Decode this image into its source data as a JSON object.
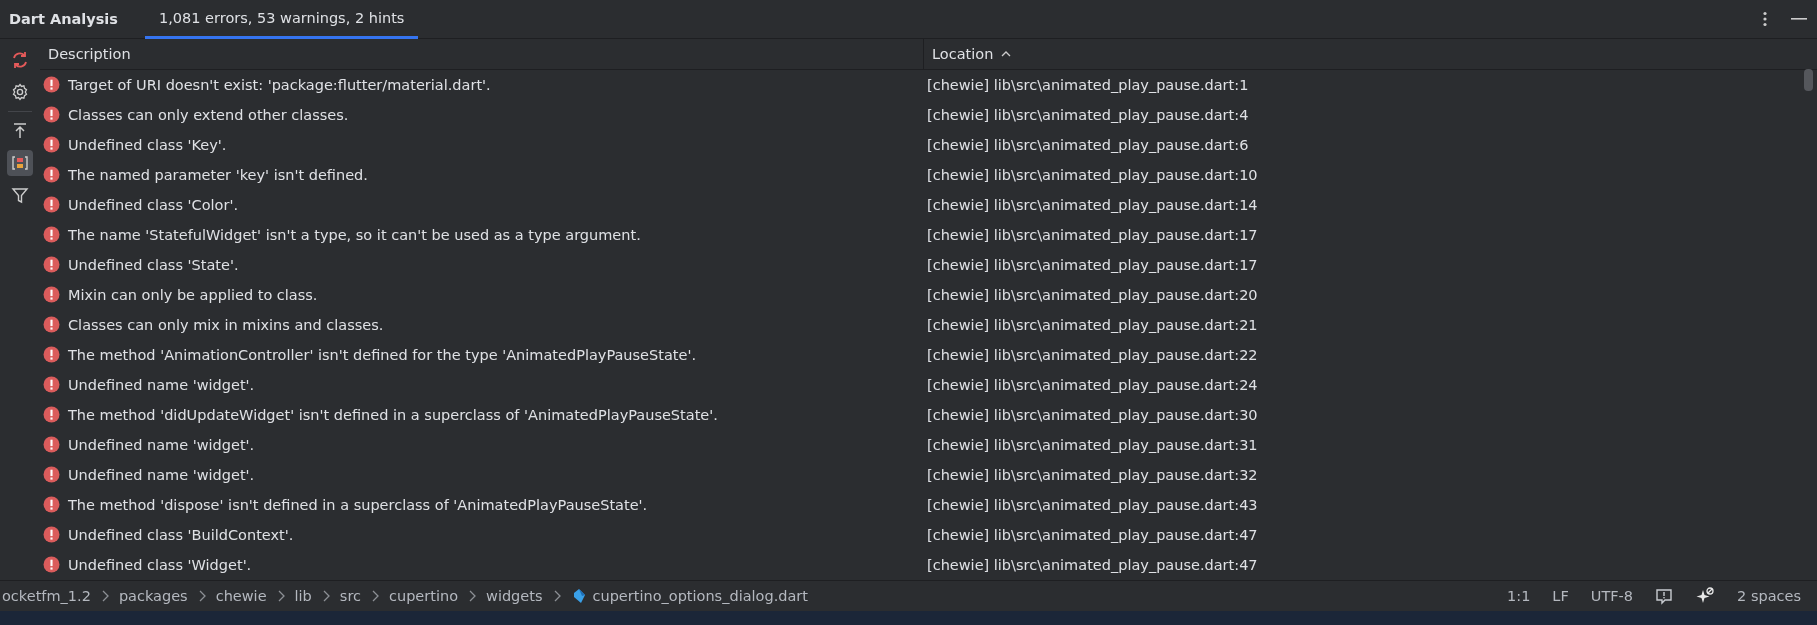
{
  "panel": {
    "title": "Dart Analysis",
    "tabs": [
      {
        "label": "1,081 errors, 53 warnings, 2 hints",
        "selected": true
      }
    ]
  },
  "toolbar": [
    {
      "kind": "refresh",
      "selected": false
    },
    {
      "kind": "settings",
      "selected": false
    },
    {
      "kind": "divider"
    },
    {
      "kind": "export",
      "selected": false
    },
    {
      "kind": "group",
      "selected": true
    },
    {
      "kind": "filter",
      "selected": false
    }
  ],
  "table": {
    "columns": [
      {
        "label": "Description",
        "sorted": false
      },
      {
        "label": "Location",
        "sorted": true
      }
    ],
    "rows": [
      {
        "kind": "error",
        "description": "Target of URI doesn't exist: 'package:flutter/material.dart'.",
        "location": "[chewie] lib\\src\\animated_play_pause.dart:1"
      },
      {
        "kind": "error",
        "description": "Classes can only extend other classes.",
        "location": "[chewie] lib\\src\\animated_play_pause.dart:4"
      },
      {
        "kind": "error",
        "description": "Undefined class 'Key'.",
        "location": "[chewie] lib\\src\\animated_play_pause.dart:6"
      },
      {
        "kind": "error",
        "description": "The named parameter 'key' isn't defined.",
        "location": "[chewie] lib\\src\\animated_play_pause.dart:10"
      },
      {
        "kind": "error",
        "description": "Undefined class 'Color'.",
        "location": "[chewie] lib\\src\\animated_play_pause.dart:14"
      },
      {
        "kind": "error",
        "description": "The name 'StatefulWidget' isn't a type, so it can't be used as a type argument.",
        "location": "[chewie] lib\\src\\animated_play_pause.dart:17"
      },
      {
        "kind": "error",
        "description": "Undefined class 'State'.",
        "location": "[chewie] lib\\src\\animated_play_pause.dart:17"
      },
      {
        "kind": "error",
        "description": "Mixin can only be applied to class.",
        "location": "[chewie] lib\\src\\animated_play_pause.dart:20"
      },
      {
        "kind": "error",
        "description": "Classes can only mix in mixins and classes.",
        "location": "[chewie] lib\\src\\animated_play_pause.dart:21"
      },
      {
        "kind": "error",
        "description": "The method 'AnimationController' isn't defined for the type 'AnimatedPlayPauseState'.",
        "location": "[chewie] lib\\src\\animated_play_pause.dart:22"
      },
      {
        "kind": "error",
        "description": "Undefined name 'widget'.",
        "location": "[chewie] lib\\src\\animated_play_pause.dart:24"
      },
      {
        "kind": "error",
        "description": "The method 'didUpdateWidget' isn't defined in a superclass of 'AnimatedPlayPauseState'.",
        "location": "[chewie] lib\\src\\animated_play_pause.dart:30"
      },
      {
        "kind": "error",
        "description": "Undefined name 'widget'.",
        "location": "[chewie] lib\\src\\animated_play_pause.dart:31"
      },
      {
        "kind": "error",
        "description": "Undefined name 'widget'.",
        "location": "[chewie] lib\\src\\animated_play_pause.dart:32"
      },
      {
        "kind": "error",
        "description": "The method 'dispose' isn't defined in a superclass of 'AnimatedPlayPauseState'.",
        "location": "[chewie] lib\\src\\animated_play_pause.dart:43"
      },
      {
        "kind": "error",
        "description": "Undefined class 'BuildContext'.",
        "location": "[chewie] lib\\src\\animated_play_pause.dart:47"
      },
      {
        "kind": "error",
        "description": "Undefined class 'Widget'.",
        "location": "[chewie] lib\\src\\animated_play_pause.dart:47"
      }
    ]
  },
  "breadcrumbs": [
    {
      "label": "ocketfm_1.2",
      "kind": "folder"
    },
    {
      "label": "packages",
      "kind": "folder"
    },
    {
      "label": "chewie",
      "kind": "folder"
    },
    {
      "label": "lib",
      "kind": "folder"
    },
    {
      "label": "src",
      "kind": "folder"
    },
    {
      "label": "cupertino",
      "kind": "folder"
    },
    {
      "label": "widgets",
      "kind": "folder"
    },
    {
      "label": "cupertino_options_dialog.dart",
      "kind": "dart-file"
    }
  ],
  "status_bar": [
    {
      "kind": "text",
      "label": "1:1"
    },
    {
      "kind": "text",
      "label": "LF"
    },
    {
      "kind": "text",
      "label": "UTF-8"
    },
    {
      "kind": "problems"
    },
    {
      "kind": "ai"
    },
    {
      "kind": "text",
      "label": "2 spaces"
    }
  ]
}
